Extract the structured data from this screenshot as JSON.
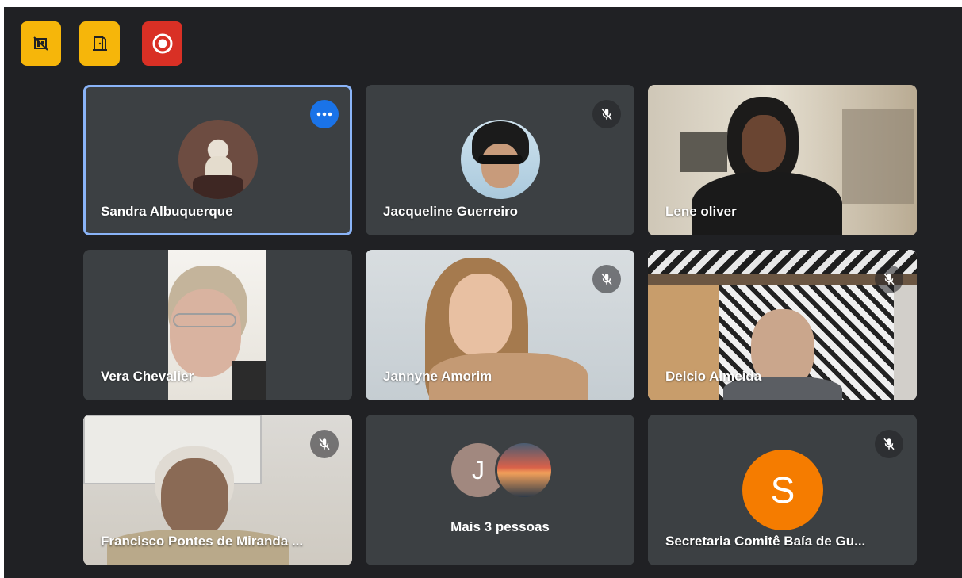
{
  "toolbar": {
    "buttons": [
      {
        "icon": "no-camera-scene-icon",
        "color": "#f6b60a"
      },
      {
        "icon": "exit-door-icon",
        "color": "#f6b60a"
      },
      {
        "icon": "record-icon",
        "color": "#d93025"
      }
    ]
  },
  "participants": [
    {
      "name": "Sandra Albuquerque",
      "active": true,
      "muted": false,
      "more_options": true
    },
    {
      "name": "Jacqueline Guerreiro",
      "muted": true
    },
    {
      "name": "Lene oliver",
      "muted": false
    },
    {
      "name": "Vera Chevalier",
      "muted": false
    },
    {
      "name": "Jannyne Amorim",
      "muted": true
    },
    {
      "name": "Delcio Almeida",
      "muted": true
    },
    {
      "name": "Francisco Pontes de Miranda ...",
      "muted": true
    },
    {
      "name": "Secretaria Comitê Baía de Gu...",
      "muted": true,
      "avatar_letter": "S",
      "avatar_color": "#f57c00"
    }
  ],
  "more_people": {
    "label": "Mais 3 pessoas",
    "avatar_letter": "J",
    "avatar_color": "#a1887f"
  },
  "colors": {
    "background": "#202124",
    "tile": "#3c4043",
    "active_border": "#8ab4f8",
    "more_button": "#1a73e8"
  }
}
